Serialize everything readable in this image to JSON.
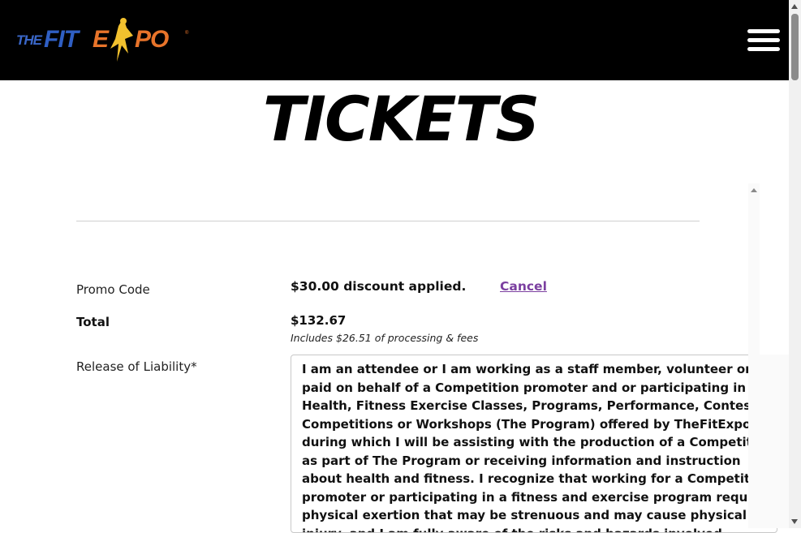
{
  "header": {
    "logo_text": "THE FIT EXPO",
    "menu_icon": "hamburger-icon"
  },
  "page": {
    "title": "TICKETS"
  },
  "form": {
    "promo_label": "Promo Code",
    "discount_text": "$30.00 discount applied.",
    "cancel_label": "Cancel",
    "total_label": "Total",
    "total_value": "$132.67",
    "fees_note": "Includes $26.51 of processing & fees",
    "release_label": "Release of Liability",
    "required_mark": "*",
    "release_text": "I am an attendee or I am working as a staff member, volunteer or paid on behalf of a Competition promoter and or participating in Health, Fitness Exercise Classes, Programs, Performance, Contests, Competitions or Workshops (The Program) offered by TheFitExpo ™ during which I will be assisting with the production of a Competition as part of The Program or receiving information and instruction about health and fitness. I recognize that working for a Competition promoter or participating in a fitness and exercise program requires physical exertion that may be strenuous and may cause physical injury, and I am fully aware of the risks and hazards involved."
  },
  "colors": {
    "header_bg": "#000000",
    "link": "#7b3fa0"
  }
}
